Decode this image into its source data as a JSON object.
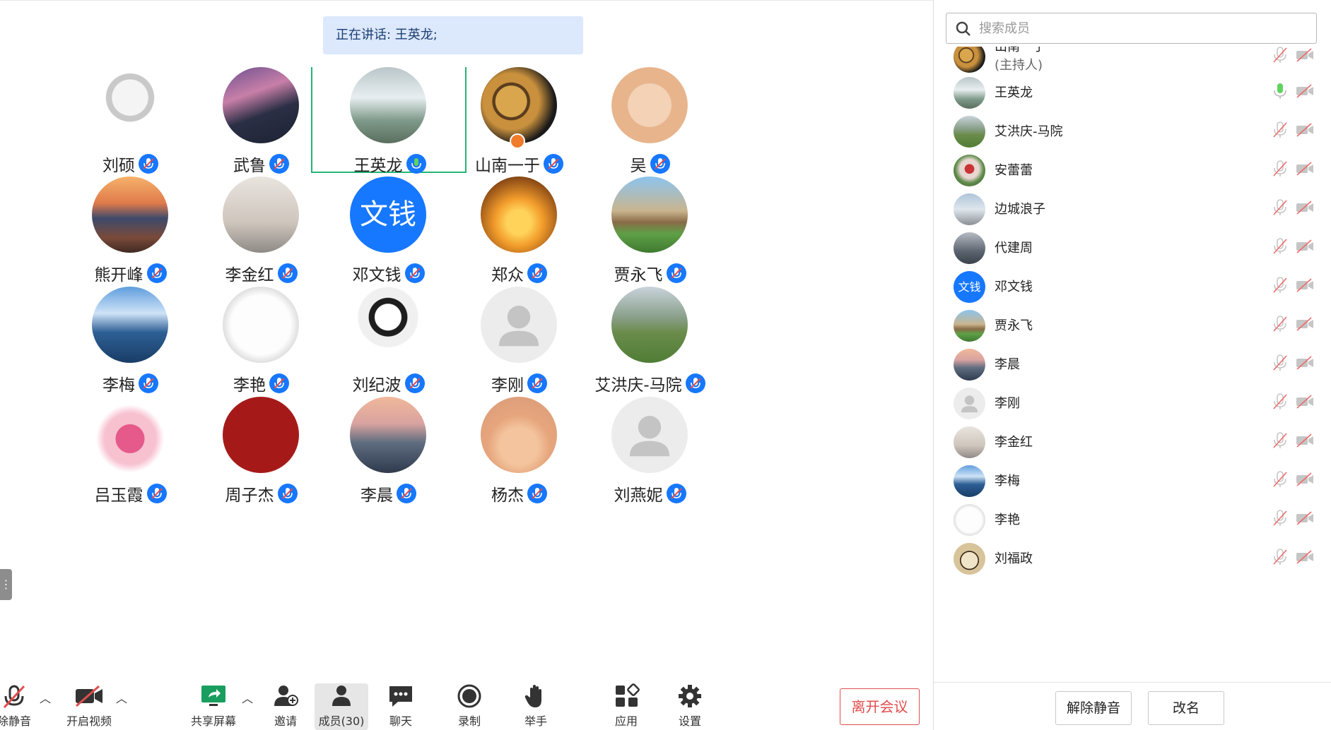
{
  "speaking": "正在讲话: 王英龙;",
  "colors": {
    "accent": "#1677ff",
    "active_border": "#22b573",
    "leave": "#e24d4d",
    "speaking_bg": "#dce8fb"
  },
  "grid": [
    {
      "name": "刘硕",
      "mic": "muted",
      "avatar": "cat-cartoon"
    },
    {
      "name": "武鲁",
      "mic": "muted",
      "avatar": "mountain-galaxy"
    },
    {
      "name": "王英龙",
      "mic": "active",
      "avatar": "waterfall",
      "active": true
    },
    {
      "name": "山南一于",
      "mic": "muted",
      "avatar": "leopard",
      "host": true
    },
    {
      "name": "吴",
      "mic": "muted",
      "avatar": "kitten"
    },
    {
      "name": "熊开峰",
      "mic": "muted",
      "avatar": "coastal-town"
    },
    {
      "name": "李金红",
      "mic": "muted",
      "avatar": "dancer"
    },
    {
      "name": "邓文钱",
      "mic": "muted",
      "avatar_text": "文钱"
    },
    {
      "name": "郑众",
      "mic": "muted",
      "avatar": "runner-sunset"
    },
    {
      "name": "贾永飞",
      "mic": "muted",
      "avatar": "campus-building"
    },
    {
      "name": "李梅",
      "mic": "muted",
      "avatar": "sky-lake"
    },
    {
      "name": "李艳",
      "mic": "muted",
      "avatar": "sketch-face"
    },
    {
      "name": "刘纪波",
      "mic": "muted",
      "avatar": "panda"
    },
    {
      "name": "李刚",
      "mic": "muted",
      "avatar": "default-person"
    },
    {
      "name": "艾洪庆-马院",
      "mic": "muted",
      "avatar": "park"
    },
    {
      "name": "吕玉霞",
      "mic": "muted",
      "avatar": "candy-heart"
    },
    {
      "name": "周子杰",
      "mic": "muted",
      "avatar": "red-calligraphy"
    },
    {
      "name": "李晨",
      "mic": "muted",
      "avatar": "astronaut"
    },
    {
      "name": "杨杰",
      "mic": "muted",
      "avatar": "heart-hands"
    },
    {
      "name": "刘燕妮",
      "mic": "muted",
      "avatar": "default-person"
    }
  ],
  "toolbar": {
    "mute": "除静音",
    "video": "开启视频",
    "share": "共享屏幕",
    "invite": "邀请",
    "members": "成员(30)",
    "chat": "聊天",
    "record": "录制",
    "raise_hand": "举手",
    "apps": "应用",
    "settings": "设置",
    "leave": "离开会议"
  },
  "panel": {
    "search_placeholder": "搜索成员",
    "members": [
      {
        "name": "山南一于",
        "role": "(主持人)",
        "mic": "muted",
        "avatar": "leopard"
      },
      {
        "name": "王英龙",
        "mic": "active",
        "avatar": "waterfall"
      },
      {
        "name": "艾洪庆-马院",
        "mic": "muted",
        "avatar": "park"
      },
      {
        "name": "安蕾蕾",
        "mic": "muted",
        "avatar": "flowers"
      },
      {
        "name": "边城浪子",
        "mic": "muted",
        "avatar": "bridge"
      },
      {
        "name": "代建周",
        "mic": "muted",
        "avatar": "statue"
      },
      {
        "name": "邓文钱",
        "mic": "muted",
        "avatar_text": "文钱"
      },
      {
        "name": "贾永飞",
        "mic": "muted",
        "avatar": "campus-building"
      },
      {
        "name": "李晨",
        "mic": "muted",
        "avatar": "astronaut"
      },
      {
        "name": "李刚",
        "mic": "muted",
        "avatar": "default-person"
      },
      {
        "name": "李金红",
        "mic": "muted",
        "avatar": "dancer"
      },
      {
        "name": "李梅",
        "mic": "muted",
        "avatar": "sky-lake"
      },
      {
        "name": "李艳",
        "mic": "muted",
        "avatar": "sketch-face"
      },
      {
        "name": "刘福政",
        "mic": "muted",
        "avatar": "fan"
      }
    ],
    "unmute_all": "解除静音",
    "rename": "改名"
  }
}
